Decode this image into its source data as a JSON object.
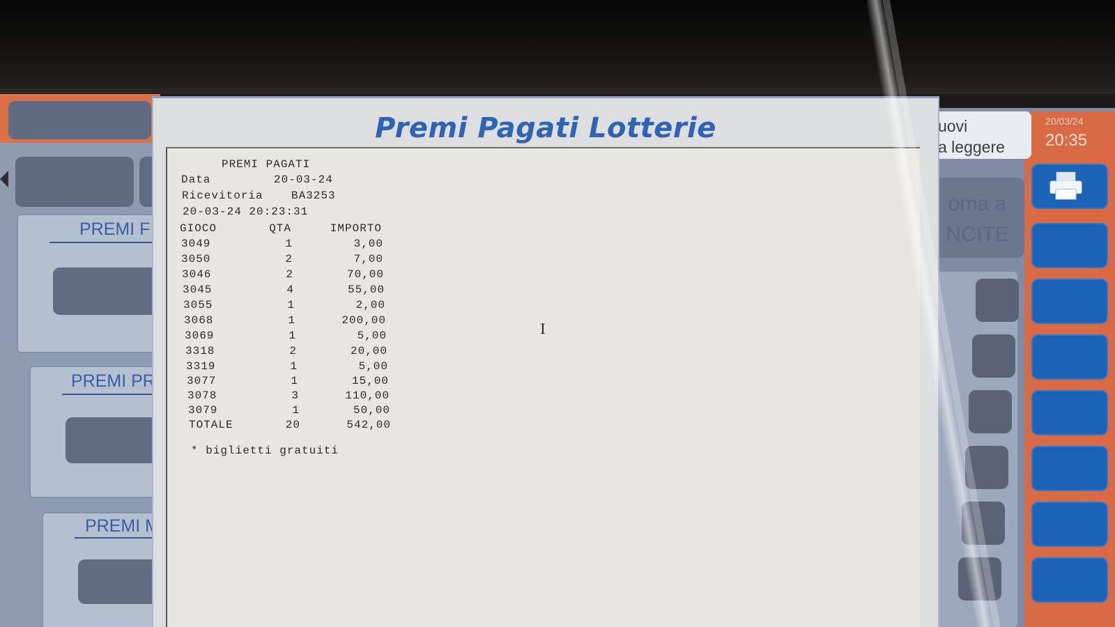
{
  "dialog": {
    "title": "Premi Pagati Lotterie"
  },
  "receipt": {
    "header": "PREMI PAGATI",
    "data_label": "Data",
    "data_value": "20-03-24",
    "ricevitoria_label": "Ricevitoria",
    "ricevitoria_value": "BA3253",
    "datetime": "20-03-24  20:23:31",
    "columns": [
      "GIOCO",
      "QTA",
      "IMPORTO"
    ],
    "rows": [
      {
        "gioco": "3049",
        "qta": "1",
        "importo": "3,00"
      },
      {
        "gioco": "3050",
        "qta": "2",
        "importo": "7,00"
      },
      {
        "gioco": "3046",
        "qta": "2",
        "importo": "70,00"
      },
      {
        "gioco": "3045",
        "qta": "4",
        "importo": "55,00"
      },
      {
        "gioco": "3055",
        "qta": "1",
        "importo": "2,00"
      },
      {
        "gioco": "3068",
        "qta": "1",
        "importo": "200,00"
      },
      {
        "gioco": "3069",
        "qta": "1",
        "importo": "5,00"
      },
      {
        "gioco": "3318",
        "qta": "2",
        "importo": "20,00"
      },
      {
        "gioco": "3319",
        "qta": "1",
        "importo": "5,00"
      },
      {
        "gioco": "3077",
        "qta": "1",
        "importo": "15,00"
      },
      {
        "gioco": "3078",
        "qta": "3",
        "importo": "110,00"
      },
      {
        "gioco": "3079",
        "qta": "1",
        "importo": "50,00"
      }
    ],
    "totale": {
      "gioco": "TOTALE",
      "qta": "20",
      "importo": "542,00"
    },
    "note": "* biglietti gratuiti"
  },
  "background": {
    "premi_cards": [
      "PREMI F",
      "PREMI PR",
      "PREMI ME"
    ],
    "messages_line1": "uovi",
    "messages_line2": "a leggere",
    "date": "20/03/24",
    "time": "20:35",
    "big_button_line1": "oma a",
    "big_button_line2": "NCITE"
  },
  "colors": {
    "title": "#2f63b3",
    "orange_frame": "#d86a45",
    "blue_button": "#1c63b7"
  }
}
